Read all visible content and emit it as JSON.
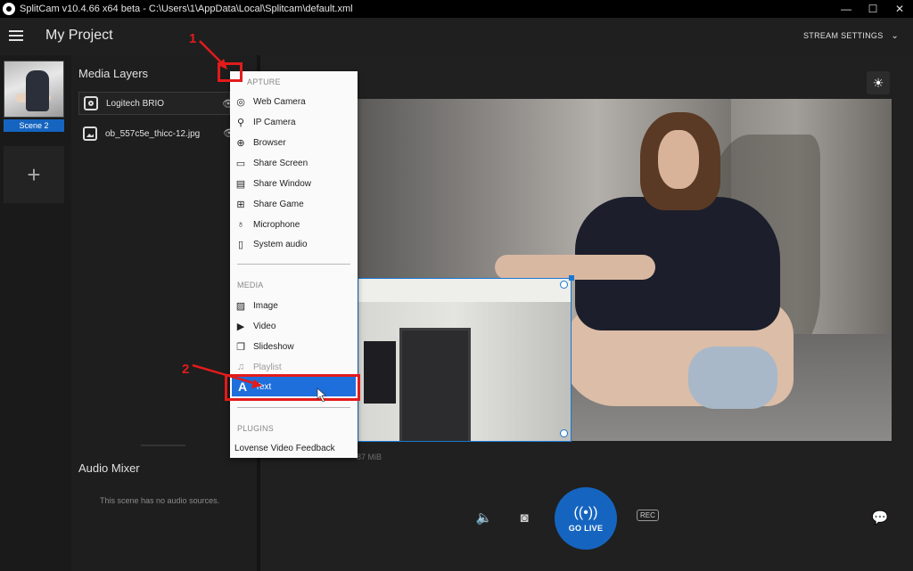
{
  "window": {
    "title": "SplitCam v10.4.66 x64 beta - C:\\Users\\1\\AppData\\Local\\Splitcam\\default.xml",
    "controls": {
      "minimize": "—",
      "maximize": "☐",
      "close": "✕"
    }
  },
  "header": {
    "project_title": "My Project",
    "stream_settings": "STREAM SETTINGS",
    "stream_settings_caret": "⌄"
  },
  "scenes": {
    "items": [
      {
        "label": "Scene 2"
      }
    ],
    "add_label": "+"
  },
  "layers": {
    "title": "Media Layers",
    "items": [
      {
        "label": "Logitech BRIO",
        "icon": "webcam-icon"
      },
      {
        "label": "ob_557c5e_thicc-12.jpg",
        "icon": "image-icon"
      }
    ],
    "eye_glyph": "👁"
  },
  "audio": {
    "title": "Audio Mixer",
    "empty_text": "This scene has no audio sources."
  },
  "preview": {
    "stats_text": "87 MiB"
  },
  "controls": {
    "go_live": "GO LIVE",
    "rec": "REC"
  },
  "dropdown": {
    "capture_header": "CAPTURE",
    "capture_header_visible": "APTURE",
    "capture_items": [
      {
        "label": "Web Camera",
        "icon": "webcam-icon",
        "glyph": "◎"
      },
      {
        "label": "IP Camera",
        "icon": "ip-camera-icon",
        "glyph": "⚲"
      },
      {
        "label": "Browser",
        "icon": "globe-icon",
        "glyph": "⊕"
      },
      {
        "label": "Share Screen",
        "icon": "share-screen-icon",
        "glyph": "▭"
      },
      {
        "label": "Share Window",
        "icon": "share-window-icon",
        "glyph": "▤"
      },
      {
        "label": "Share Game",
        "icon": "gamepad-icon",
        "glyph": "⊞"
      },
      {
        "label": "Microphone",
        "icon": "microphone-icon",
        "glyph": "♁"
      },
      {
        "label": "System audio",
        "icon": "speaker-icon",
        "glyph": "▯"
      }
    ],
    "media_header": "MEDIA",
    "media_items": [
      {
        "label": "Image",
        "icon": "image-icon",
        "glyph": "▨"
      },
      {
        "label": "Video",
        "icon": "video-icon",
        "glyph": "▶"
      },
      {
        "label": "Slideshow",
        "icon": "slideshow-icon",
        "glyph": "❐"
      },
      {
        "label": "Playlist",
        "icon": "playlist-icon",
        "glyph": "♫"
      },
      {
        "label": "Text",
        "icon": "text-icon",
        "glyph": "A"
      }
    ],
    "plugins_header": "PLUGINS",
    "plugin_items": [
      {
        "label": "Lovense Video Feedback"
      }
    ]
  },
  "annotations": {
    "step1": "1",
    "step2": "2",
    "color": "#e21b1b"
  },
  "colors": {
    "accent": "#1565c0",
    "selection": "#1e6fdc",
    "background": "#1f1f1f"
  }
}
